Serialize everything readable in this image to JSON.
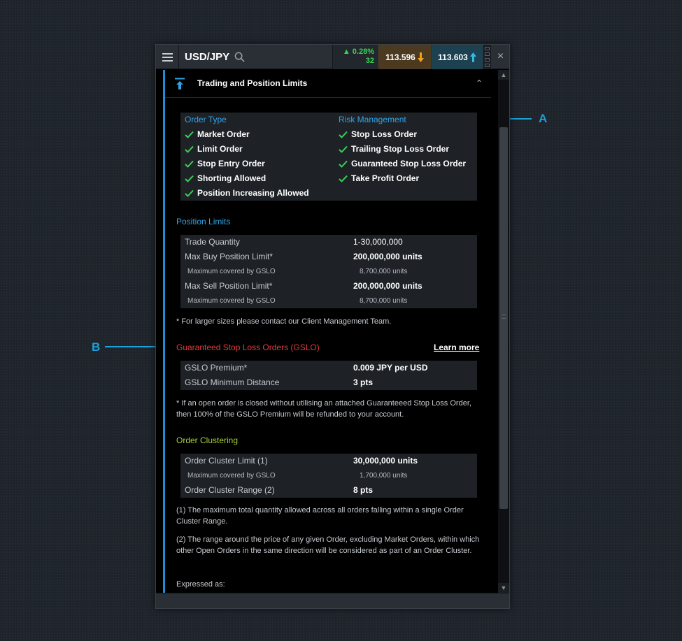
{
  "header": {
    "symbol": "USD/JPY",
    "change_percent": "0.28%",
    "change_points": "32",
    "sell_price": "113.596",
    "buy_price": "113.603",
    "close_glyph": "×"
  },
  "section": {
    "title": "Trading and Position Limits",
    "collapse_glyph": "⌃"
  },
  "order_type": {
    "heading": "Order Type",
    "items": [
      "Market Order",
      "Limit Order",
      "Stop Entry Order",
      "Shorting Allowed",
      "Position Increasing Allowed"
    ]
  },
  "risk_management": {
    "heading": "Risk Management",
    "items": [
      "Stop Loss Order",
      "Trailing Stop Loss Order",
      "Guaranteed Stop Loss Order",
      "Take Profit Order"
    ]
  },
  "position_limits": {
    "heading": "Position Limits",
    "rows": [
      {
        "label": "Trade Quantity",
        "value": "1-30,000,000"
      },
      {
        "label": "Max Buy Position Limit*",
        "value": "200,000,000 units"
      },
      {
        "label": "Maximum covered by GSLO",
        "value": "8,700,000 units"
      },
      {
        "label": "Max Sell Position Limit*",
        "value": "200,000,000 units"
      },
      {
        "label": "Maximum covered by GSLO",
        "value": "8,700,000 units"
      }
    ],
    "note": "* For larger sizes please contact our Client Management Team."
  },
  "gslo": {
    "heading": "Guaranteed Stop Loss Orders (GSLO)",
    "learn_more": "Learn more",
    "rows": [
      {
        "label": "GSLO Premium*",
        "value": "0.009 JPY per USD"
      },
      {
        "label": "GSLO Minimum Distance",
        "value": "3  pts"
      }
    ],
    "note": "* If an open order is closed without utilising an attached Guaranteeed Stop Loss Order, then 100% of the GSLO Premium will be refunded to your account."
  },
  "order_clustering": {
    "heading": "Order Clustering",
    "rows": [
      {
        "label": "Order Cluster Limit (1)",
        "value": "30,000,000 units"
      },
      {
        "label": "Maximum covered by GSLO",
        "value": "1,700,000 units"
      },
      {
        "label": "Order Cluster Range (2)",
        "value": "8 pts"
      }
    ],
    "note1": "(1) The maximum total quantity allowed across all orders falling within a single Order Cluster Range.",
    "note2": "(2) The range around the price of any given Order, excluding Market Orders, within which other Open Orders in the same direction will be considered as part of an Order Cluster.",
    "expressed_as": "Expressed as:"
  },
  "callouts": {
    "a": "A",
    "b": "B"
  },
  "colors": {
    "accent_blue": "#2fa4e7",
    "gslo_red": "#e23b3b",
    "clustering_green": "#a7cf3a",
    "check_green": "#39d353",
    "callout_blue": "#1ea0dc"
  }
}
